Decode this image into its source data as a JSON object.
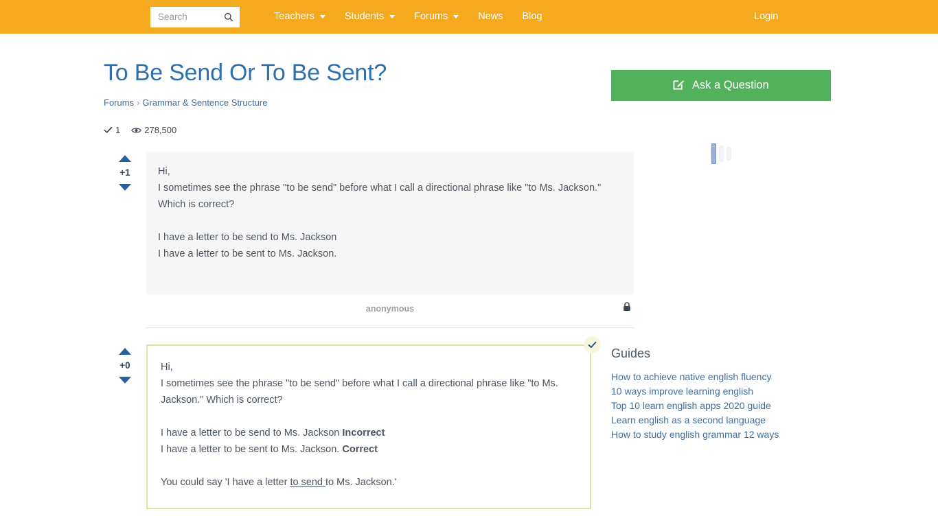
{
  "nav": {
    "search": {
      "placeholder": "Search",
      "value": "",
      "icon": "search-icon"
    },
    "items": [
      {
        "label": "Teachers",
        "has_caret": true
      },
      {
        "label": "Students",
        "has_caret": true
      },
      {
        "label": "Forums",
        "has_caret": true
      },
      {
        "label": "News",
        "has_caret": false
      },
      {
        "label": "Blog",
        "has_caret": false
      }
    ],
    "login_label": "Login",
    "background_color": "#f4a91f"
  },
  "page": {
    "title": "To Be Send Or To Be Sent?",
    "title_color": "#2f6fad",
    "breadcrumb": {
      "root": "Forums",
      "separator": "›",
      "current": "Grammar & Sentence Structure"
    },
    "stats": {
      "answers_icon": "check-icon",
      "answers_count": "1",
      "views_icon": "eye-icon",
      "views_count": "278,500"
    }
  },
  "question": {
    "vote": {
      "up_icon": "triangle-up-icon",
      "down_icon": "triangle-down-icon",
      "score": "+1"
    },
    "lines": [
      "Hi,",
      "I sometimes see the phrase \"to be send\" before what I call a directional phrase like \"to Ms. Jackson.\" Which is correct?",
      "",
      "I have a letter to be send to Ms. Jackson",
      "I have a letter to be sent to Ms. Jackson."
    ],
    "author": "anonymous",
    "lock_icon": "lock-icon"
  },
  "answer": {
    "vote": {
      "up_icon": "triangle-up-icon",
      "down_icon": "triangle-down-icon",
      "score": "+0"
    },
    "accepted_badge_icon": "check-icon",
    "border_color": "#d9e5a0",
    "lines": [
      {
        "text": "Hi,"
      },
      {
        "text": "I sometimes see the phrase \"to be send\" before what I call a directional phrase like \"to Ms. Jackson.\" Which is correct?"
      },
      {
        "text": ""
      },
      {
        "text": "I have a letter to be send to Ms. Jackson ",
        "bold_suffix": "Incorrect"
      },
      {
        "text": "I have a letter to be sent to Ms. Jackson. ",
        "bold_suffix": "Correct"
      },
      {
        "text": ""
      },
      {
        "prefix": "You could say 'I have a letter ",
        "underline": "to send ",
        "suffix": "to Ms. Jackson.'"
      }
    ]
  },
  "sidebar": {
    "ask_button": {
      "label": "Ask a Question",
      "icon": "pencil-square-icon",
      "color": "#53b15c"
    },
    "guides_title": "Guides",
    "guides": [
      "How to achieve native english fluency",
      "10 ways improve learning english",
      "Top 10 learn english apps 2020 guide",
      "Learn english as a second language",
      "How to study english grammar 12 ways"
    ]
  }
}
